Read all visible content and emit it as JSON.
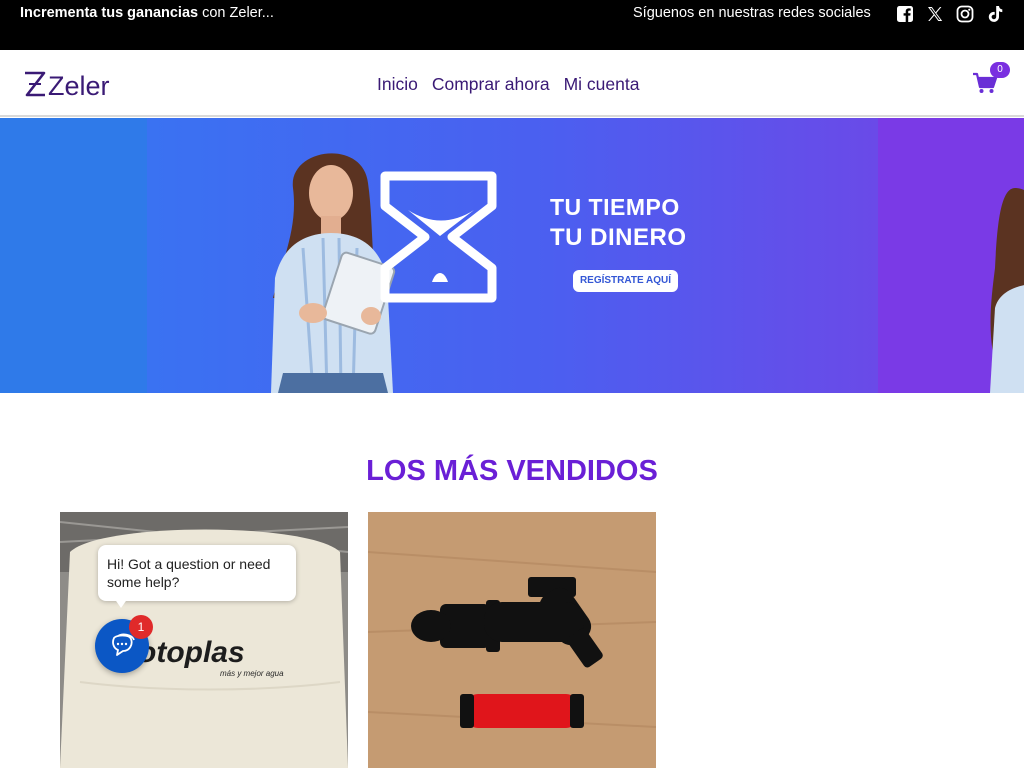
{
  "topbar": {
    "promo_bold": "Incrementa tus ganancias",
    "promo_rest": " con Zeler...",
    "follow_text": "Síguenos en nuestras redes sociales",
    "social_icons": [
      "facebook-icon",
      "x-twitter-icon",
      "instagram-icon",
      "tiktok-icon"
    ]
  },
  "header": {
    "logo_text": "Zeler",
    "nav": [
      "Inicio",
      "Comprar ahora",
      "Mi cuenta"
    ],
    "cart_count": "0"
  },
  "banner": {
    "line1": "TU TIEMPO",
    "line2": "TU DINERO",
    "button": "REGÍSTRATE AQUÍ"
  },
  "section": {
    "title": "LOS MÁS VENDIDOS"
  },
  "products": [
    {
      "image_text_line1": "otoplas",
      "image_text_line2": "más y mejor agua"
    },
    {
      "image_text_line1": ""
    }
  ],
  "chat": {
    "message": "Hi! Got a question or need some help?",
    "badge": "1"
  },
  "colors": {
    "accent": "#6a1fd6",
    "nav": "#3a1a75",
    "topbar": "#000000",
    "chat": "#0b57c5"
  }
}
